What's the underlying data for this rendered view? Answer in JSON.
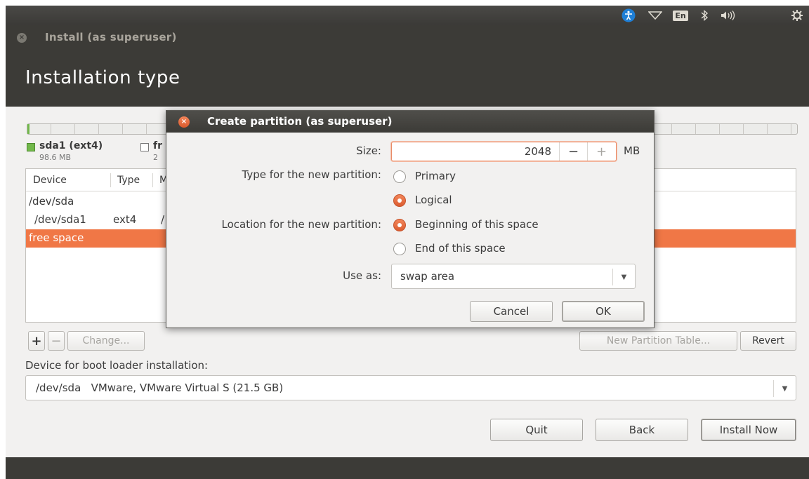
{
  "topbar": {
    "keyboard_layout": "En",
    "icons": [
      "accessibility-icon",
      "network-wifi-icon",
      "keyboard-layout-indicator",
      "bluetooth-icon",
      "volume-icon",
      "system-menu-icon"
    ]
  },
  "window": {
    "title": "Install (as superuser)",
    "page_title": "Installation type"
  },
  "disk": {
    "legend": [
      {
        "name": "sda1 (ext4)",
        "size": "98.6 MB",
        "color": "#72b84b"
      },
      {
        "name": "fr",
        "size": "2",
        "color": "#ffffff"
      }
    ]
  },
  "table": {
    "headers": [
      "Device",
      "Type",
      "M"
    ],
    "rows": [
      {
        "device": "/dev/sda",
        "type": "",
        "extra": ""
      },
      {
        "device": "/dev/sda1",
        "type": "ext4",
        "extra": "/"
      },
      {
        "device": "free space",
        "type": "",
        "extra": "",
        "selected": true
      }
    ]
  },
  "table_buttons": {
    "add": "+",
    "remove": "−",
    "change": "Change...",
    "new_partition_table": "New Partition Table...",
    "revert": "Revert"
  },
  "boot": {
    "label": "Device for boot loader installation:",
    "value": "/dev/sda   VMware, VMware Virtual S (21.5 GB)"
  },
  "footer": {
    "quit": "Quit",
    "back": "Back",
    "install_now": "Install Now"
  },
  "dialog": {
    "title": "Create partition (as superuser)",
    "size_label": "Size:",
    "size_value": "2048",
    "size_unit": "MB",
    "decrement": "−",
    "increment": "+",
    "type_label": "Type for the new partition:",
    "type_options": [
      "Primary",
      "Logical"
    ],
    "type_selected": "Logical",
    "location_label": "Location for the new partition:",
    "location_options": [
      "Beginning of this space",
      "End of this space"
    ],
    "location_selected": "Beginning of this space",
    "use_as_label": "Use as:",
    "use_as_value": "swap area",
    "cancel": "Cancel",
    "ok": "OK"
  },
  "colors": {
    "accent": "#f07746",
    "header_bg": "#3c3b37",
    "partition_ext4": "#72b84b"
  }
}
